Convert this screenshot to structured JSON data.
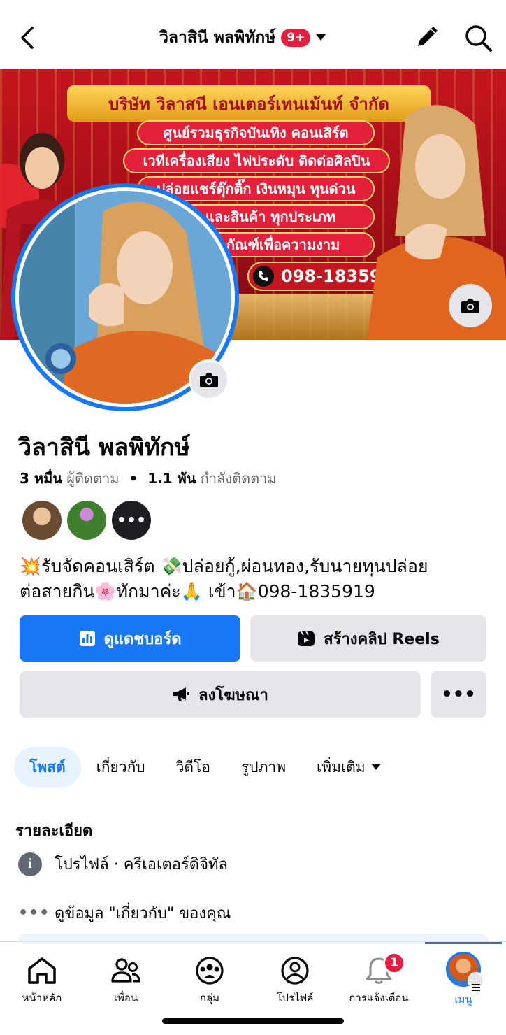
{
  "header": {
    "title": "วิลาสินี พลพิทักษ์",
    "notification_badge": "9+",
    "icons": [
      "back-icon",
      "caret-down-icon",
      "edit-pencil-icon",
      "search-icon"
    ]
  },
  "cover": {
    "company_name": "บริษัท วิลาสนี เอนเตอร์เทนเม้นท์ จำกัด",
    "lines": [
      "ศูนย์รวมธุรกิจบันเทิง คอนเสิร์ต",
      "เวทีเครื่องเสียง ไฟประดับ ติดต่อศิลปิน",
      "ปล่อยแชร์ตุ๊กติ๊ก เงินหมุน ทุนด่วน",
      "ทอง และสินค้า ทุกประเภท",
      "ผลิตภัณฑ์เพื่อความงาม"
    ],
    "phone": "098-1835919"
  },
  "profile": {
    "name": "วิลาสินี พลพิทักษ์",
    "followers_count": "3 หมื่น",
    "followers_label": "ผู้ติดตาม",
    "following_count": "1.1 พัน",
    "following_label": "กำลังติดตาม",
    "more_followers": "•••",
    "bio_line1": "💥รับจัดคอนเสิร์ต 💸ปล่อยกู้,ผ่อนทอง,รับนายทุนปล่อย",
    "bio_line2": "ต่อสายกิน🌸ทักมาค่ะ🙏 เข้า🏠098-1835919"
  },
  "actions": {
    "dashboard": "ดูแดชบอร์ด",
    "reels": "สร้างคลิป Reels",
    "advertise": "ลงโฆษณา",
    "more": "•••"
  },
  "tabs": [
    {
      "label": "โพสต์",
      "active": true
    },
    {
      "label": "เกี่ยวกับ",
      "active": false
    },
    {
      "label": "วิดีโอ",
      "active": false
    },
    {
      "label": "รูปภาพ",
      "active": false
    },
    {
      "label": "เพิ่มเติม",
      "active": false
    }
  ],
  "details": {
    "title": "รายละเอียด",
    "category": "โปรไฟล์ · ครีเอเตอร์ดิจิทัล",
    "info_glyph": "i",
    "about_link": "ดูข้อมูล \"เกี่ยวกับ\" ของคุณ",
    "dots_glyph": "•••"
  },
  "bottom_nav": {
    "items": [
      {
        "label": "หน้าหลัก",
        "icon": "home-icon"
      },
      {
        "label": "เพื่อน",
        "icon": "friends-icon"
      },
      {
        "label": "กลุ่ม",
        "icon": "groups-icon"
      },
      {
        "label": "โปรไฟล์",
        "icon": "profile-icon"
      },
      {
        "label": "การแจ้งเตือน",
        "icon": "bell-icon",
        "badge": "1"
      },
      {
        "label": "เมนู",
        "icon": "menu-avatar",
        "active": true
      }
    ]
  },
  "colors": {
    "accent": "#1877f2",
    "badge": "#e41e3f",
    "button_gray": "#e4e6eb",
    "cover_red": "#c5151f"
  }
}
